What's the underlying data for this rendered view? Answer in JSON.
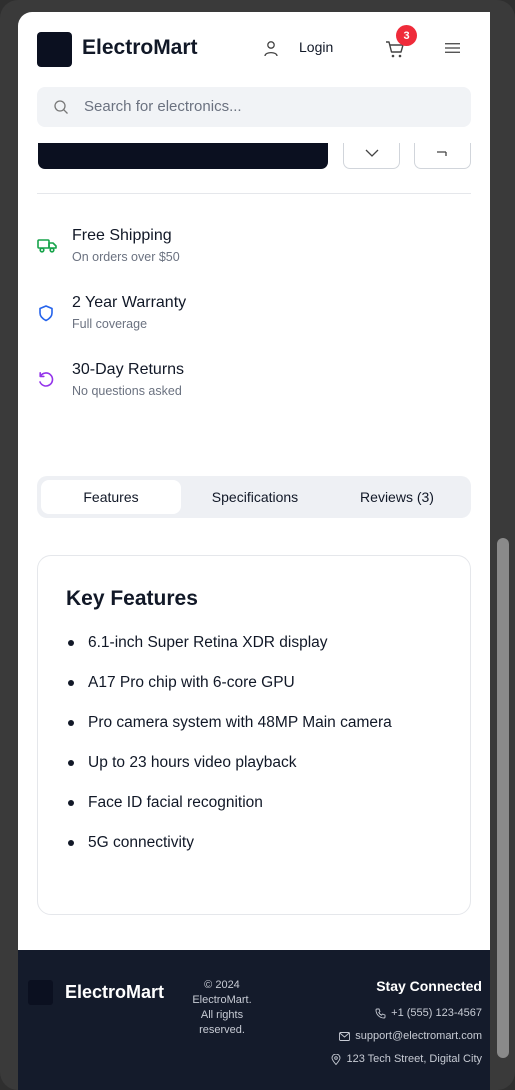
{
  "header": {
    "brand": "ElectroMart",
    "login_label": "Login",
    "cart_count": "3"
  },
  "search": {
    "placeholder": "Search for electronics..."
  },
  "perks": [
    {
      "title": "Free Shipping",
      "subtitle": "On orders over $50",
      "icon": "truck-icon",
      "color": "#16a34a"
    },
    {
      "title": "2 Year Warranty",
      "subtitle": "Full coverage",
      "icon": "shield-icon",
      "color": "#2563eb"
    },
    {
      "title": "30-Day Returns",
      "subtitle": "No questions asked",
      "icon": "rotate-ccw-icon",
      "color": "#9333ea"
    }
  ],
  "tabs": [
    {
      "label": "Features",
      "active": true
    },
    {
      "label": "Specifications",
      "active": false
    },
    {
      "label": "Reviews (3)",
      "active": false
    }
  ],
  "features_card": {
    "title": "Key Features",
    "items": [
      "6.1-inch Super Retina XDR display",
      "A17 Pro chip with 6-core GPU",
      "Pro camera system with 48MP Main camera",
      "Up to 23 hours video playback",
      "Face ID facial recognition",
      "5G connectivity"
    ]
  },
  "footer": {
    "brand": "ElectroMart",
    "copyright_line1": "© 2024",
    "copyright_line2": "ElectroMart.",
    "copyright_line3": "All rights",
    "copyright_line4": "reserved.",
    "stay_connected": "Stay Connected",
    "phone": "+1 (555) 123-4567",
    "email": "support@electromart.com",
    "address": "123 Tech Street, Digital City"
  },
  "colors": {
    "brand_dark": "#0b1020",
    "badge_red": "#ef2b3a",
    "footer_bg": "#141b2b"
  }
}
